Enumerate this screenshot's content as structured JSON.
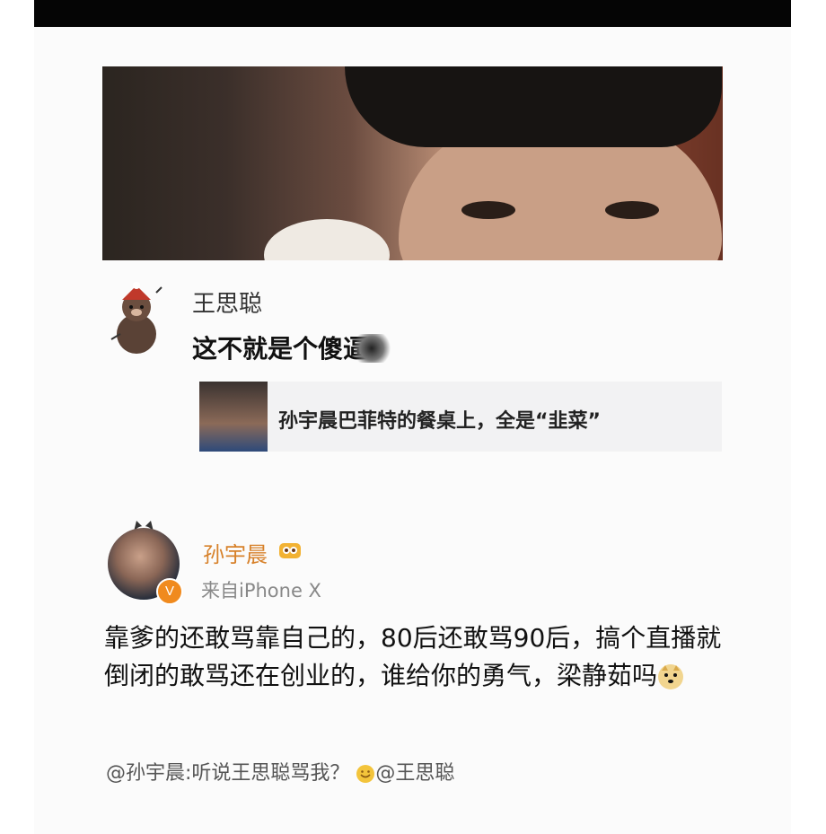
{
  "post1": {
    "username": "王思聪",
    "text": "这不就是个傻逼"
  },
  "quote": {
    "title": "孙宇晨巴菲特的餐桌上，全是“韭菜”"
  },
  "post2": {
    "username": "孙宇晨",
    "source": "来自iPhone X",
    "body": "靠爹的还敢骂靠自己的，80后还敢骂90后，搞个直播就倒闭的敢骂还在创业的，谁给你的勇气，梁静茹吗",
    "footer_prefix": "@孙宇晨:听说王思聪骂我？",
    "footer_mention": "@王思聪"
  },
  "icons": {
    "verified_badge": "V"
  },
  "colors": {
    "username_orange": "#d7812a",
    "verified_orange": "#f08a1e"
  }
}
